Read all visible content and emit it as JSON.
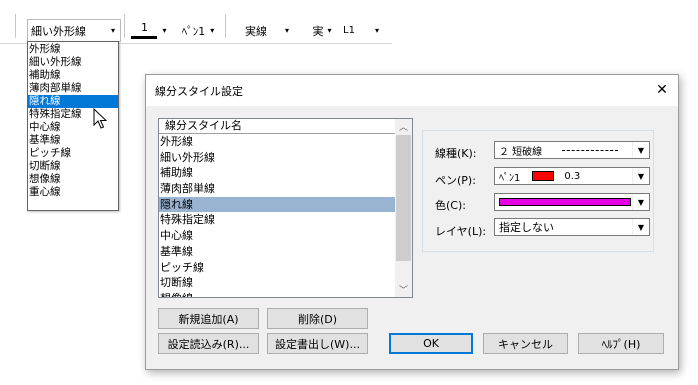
{
  "toolbar": {
    "line_type_combo": "細い外形線",
    "line_width_value": "1",
    "pen_label": "ﾍﾟﾝ1",
    "style_label": "実線",
    "style_short": "実",
    "layer_value": "L1",
    "arrow": "▾"
  },
  "dropdown": {
    "options": [
      "外形線",
      "細い外形線",
      "補助線",
      "薄肉部単線",
      "隠れ線",
      "特殊指定線",
      "中心線",
      "基準線",
      "ピッチ線",
      "切断線",
      "想像線",
      "重心線"
    ],
    "selected_index": 4
  },
  "dialog": {
    "title": "線分スタイル設定",
    "close_glyph": "✕",
    "list_header": "線分スタイル名",
    "list_items": [
      "外形線",
      "細い外形線",
      "補助線",
      "薄肉部単線",
      "隠れ線",
      "特殊指定線",
      "中心線",
      "基準線",
      "ピッチ線",
      "切断線",
      "想像線"
    ],
    "list_selected_index": 4,
    "scroll_up": "︿",
    "scroll_down": "﹀",
    "fields": {
      "line_type_label": "線種(K):",
      "line_type_value": "２ 短破線",
      "pen_label": "ペン(P):",
      "pen_value": "ﾍﾟﾝ1",
      "pen_width": "0.3",
      "pen_color": "#ff0000",
      "color_label": "色(C):",
      "color_value": "#e600e6",
      "layer_label": "レイヤ(L):",
      "layer_value": "指定しない"
    },
    "buttons": {
      "add": "新規追加(A)",
      "delete": "削除(D)",
      "load": "設定読込み(R)...",
      "export": "設定書出し(W)...",
      "ok": "OK",
      "cancel": "キャンセル",
      "help": "ﾍﾙﾌﾟ(H)"
    }
  }
}
